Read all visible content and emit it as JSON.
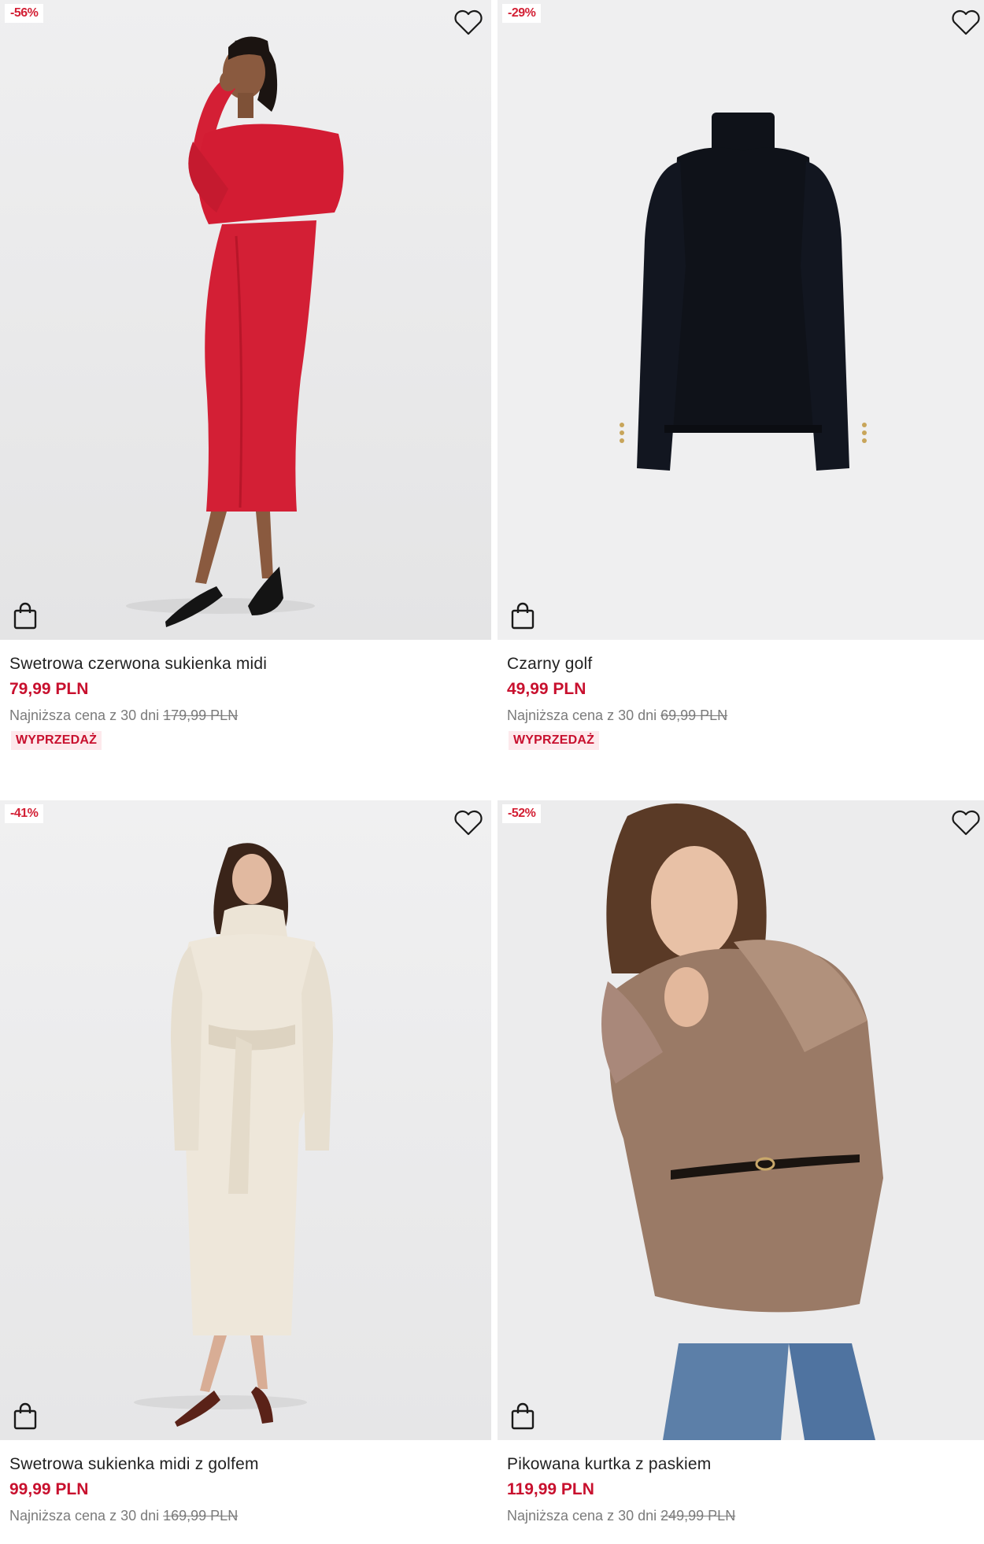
{
  "colors": {
    "sale_red": "#c8102e",
    "tag_background": "#fde9ec",
    "image_background": "#ececed"
  },
  "icons": {
    "wishlist": "heart-outline-icon",
    "add_to_cart": "shopping-bag-icon"
  },
  "products": [
    {
      "discount": "-56%",
      "name": "Swetrowa czerwona sukienka midi",
      "price": "79,99 PLN",
      "lowest_label": "Najniższa cena z 30 dni",
      "old_price": "179,99 PLN",
      "tag": "WYPRZEDAŻ",
      "image": "red knit midi dress on model"
    },
    {
      "discount": "-29%",
      "name": "Czarny golf",
      "price": "49,99 PLN",
      "lowest_label": "Najniższa cena z 30 dni",
      "old_price": "69,99 PLN",
      "tag": "WYPRZEDAŻ",
      "image": "black turtleneck sweater flat lay"
    },
    {
      "discount": "-41%",
      "name": "Swetrowa sukienka midi z golfem",
      "price": "99,99 PLN",
      "lowest_label": "Najniższa cena z 30 dni",
      "old_price": "169,99 PLN",
      "image": "cream belted turtleneck midi dress on model"
    },
    {
      "discount": "-52%",
      "name": "Pikowana kurtka z paskiem",
      "price": "119,99 PLN",
      "lowest_label": "Najniższa cena z 30 dni",
      "old_price": "249,99 PLN",
      "image": "brown quilted jacket with belt on model"
    }
  ]
}
